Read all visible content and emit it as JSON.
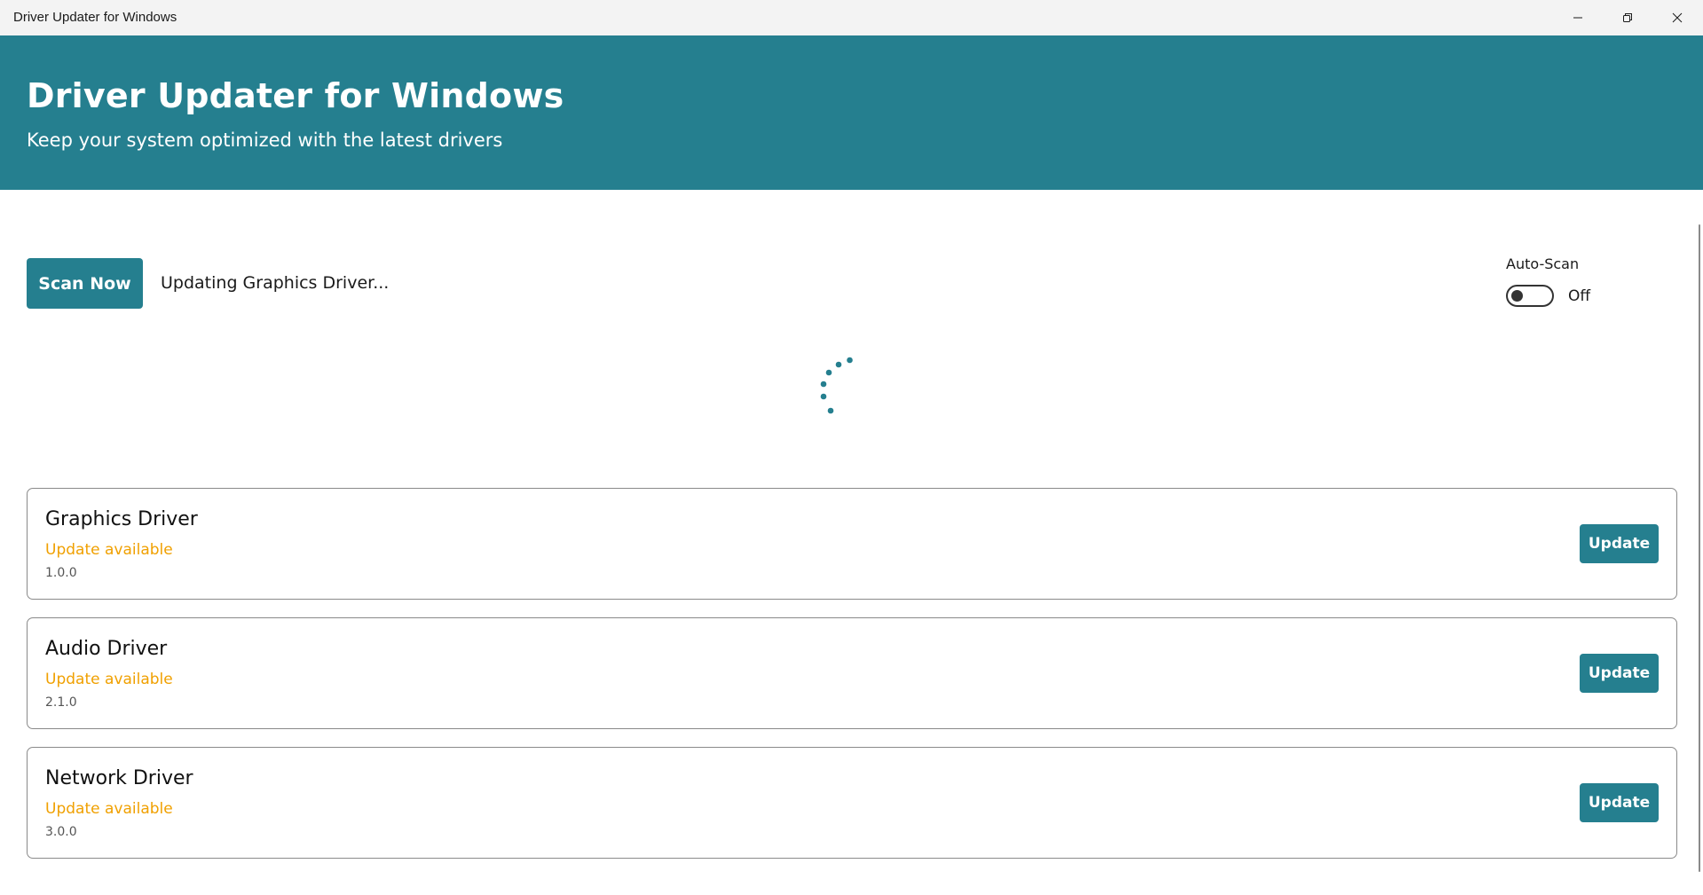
{
  "window": {
    "title": "Driver Updater for Windows"
  },
  "header": {
    "title": "Driver Updater for Windows",
    "subtitle": "Keep your system optimized with the latest drivers",
    "background_color": "#257f8f"
  },
  "toolbar": {
    "scan_label": "Scan Now",
    "status_text": "Updating Graphics Driver..."
  },
  "auto_scan": {
    "label": "Auto-Scan",
    "state_text": "Off",
    "enabled": false
  },
  "drivers": [
    {
      "name": "Graphics Driver",
      "status": "Update available",
      "version": "1.0.0",
      "action_label": "Update"
    },
    {
      "name": "Audio Driver",
      "status": "Update available",
      "version": "2.1.0",
      "action_label": "Update"
    },
    {
      "name": "Network Driver",
      "status": "Update available",
      "version": "3.0.0",
      "action_label": "Update"
    }
  ],
  "colors": {
    "accent": "#257f8f",
    "status_warning": "#f0a000"
  },
  "icons": {
    "minimize": "minimize-icon",
    "maximize": "restore-icon",
    "close": "close-icon",
    "spinner": "loading-spinner-icon"
  }
}
